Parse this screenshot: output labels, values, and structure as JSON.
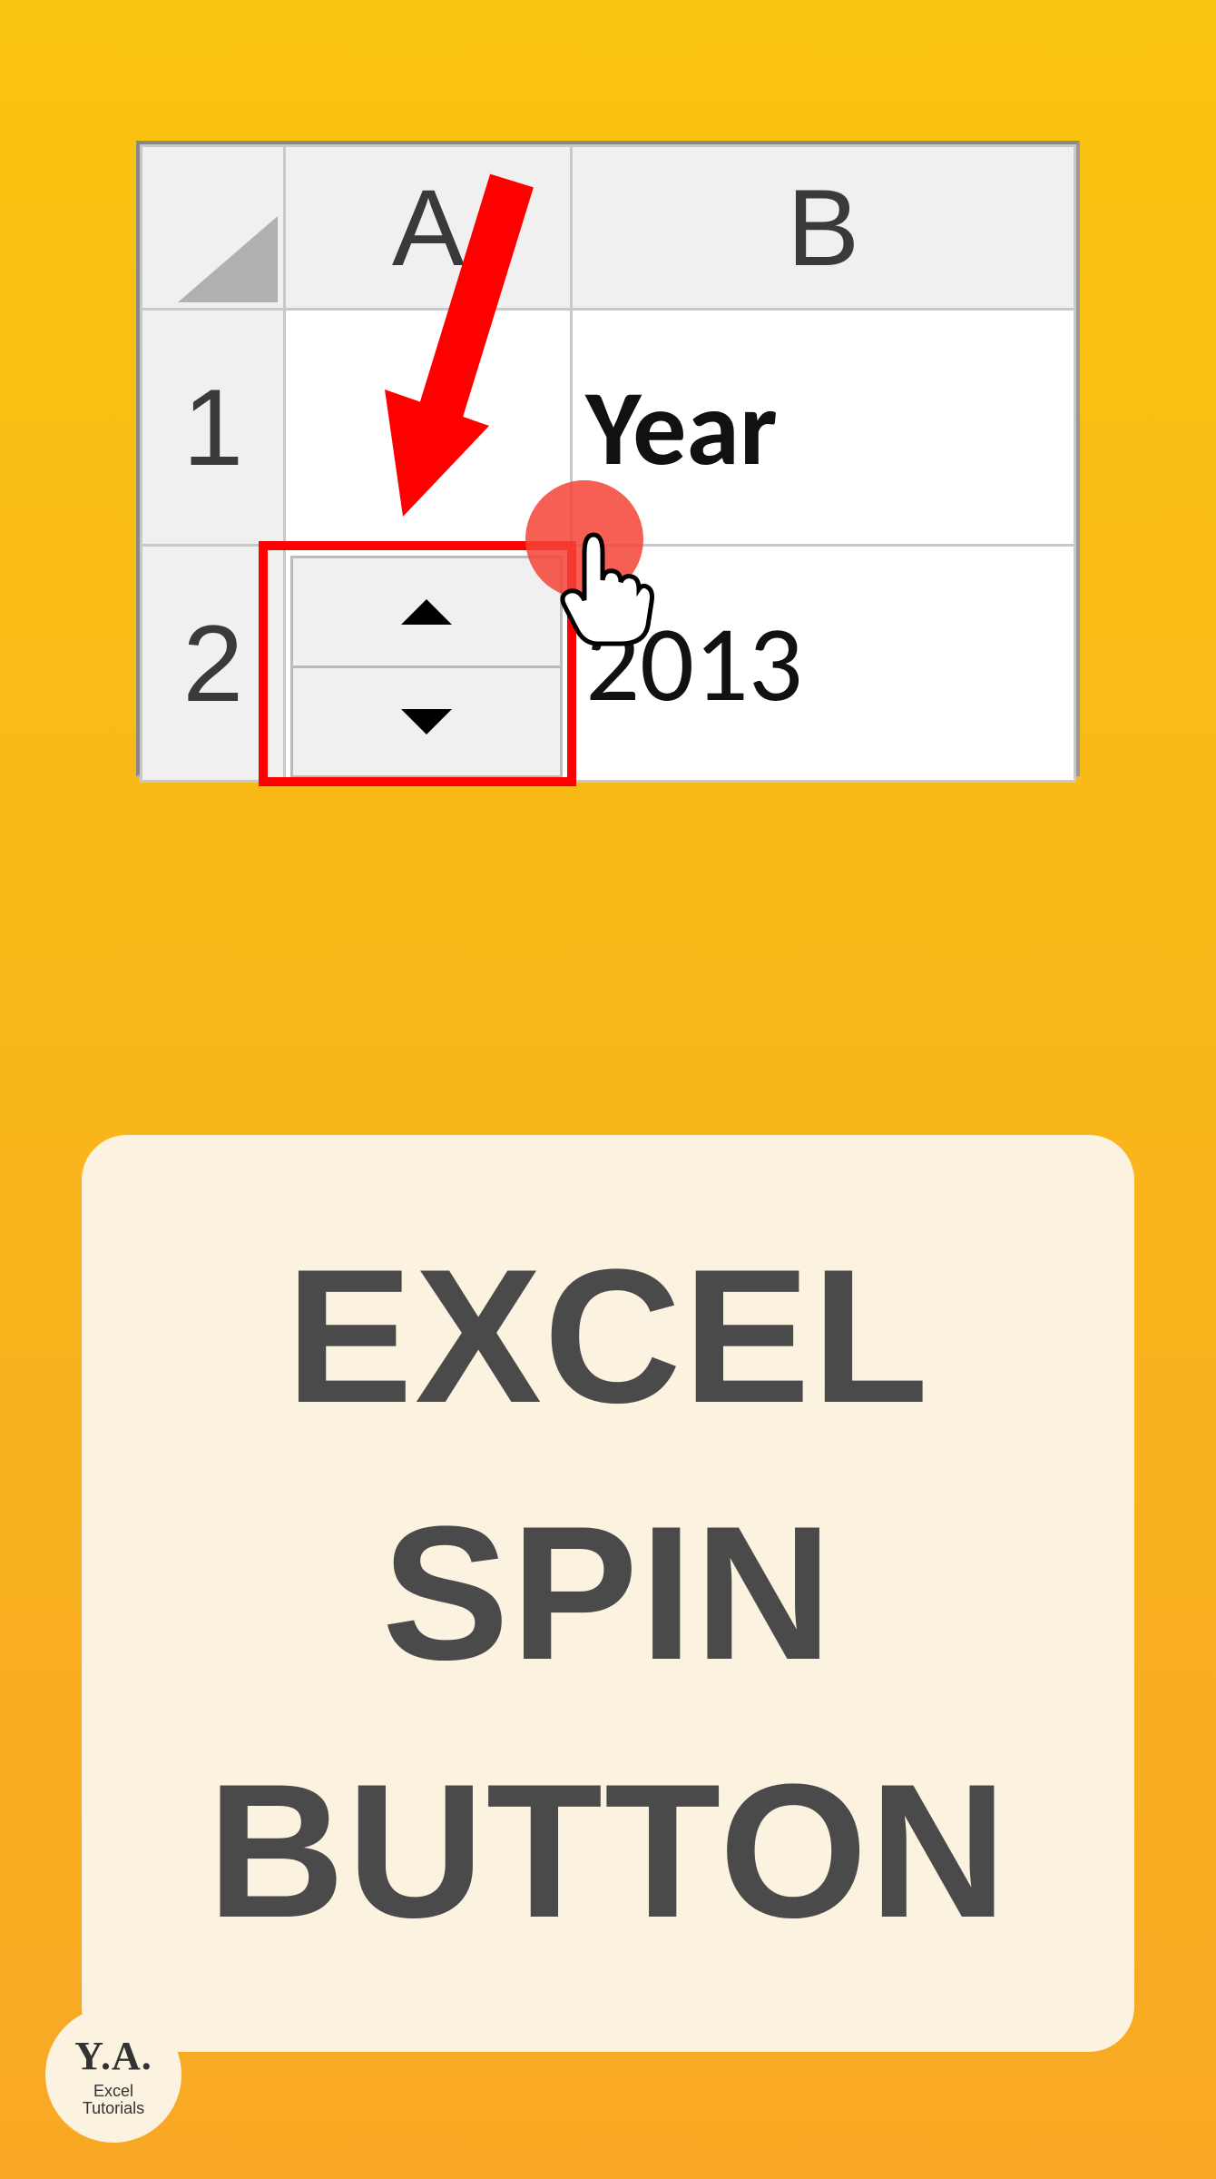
{
  "excel": {
    "columns": [
      "A",
      "B"
    ],
    "rows": [
      "1",
      "2"
    ],
    "cells": {
      "b1": "Year",
      "b2": "2013"
    }
  },
  "title": {
    "line1": "EXCEL",
    "line2": "SPIN",
    "line3": "BUTTON"
  },
  "badge": {
    "initials": "Y.A.",
    "sub1": "Excel",
    "sub2": "Tutorials"
  }
}
